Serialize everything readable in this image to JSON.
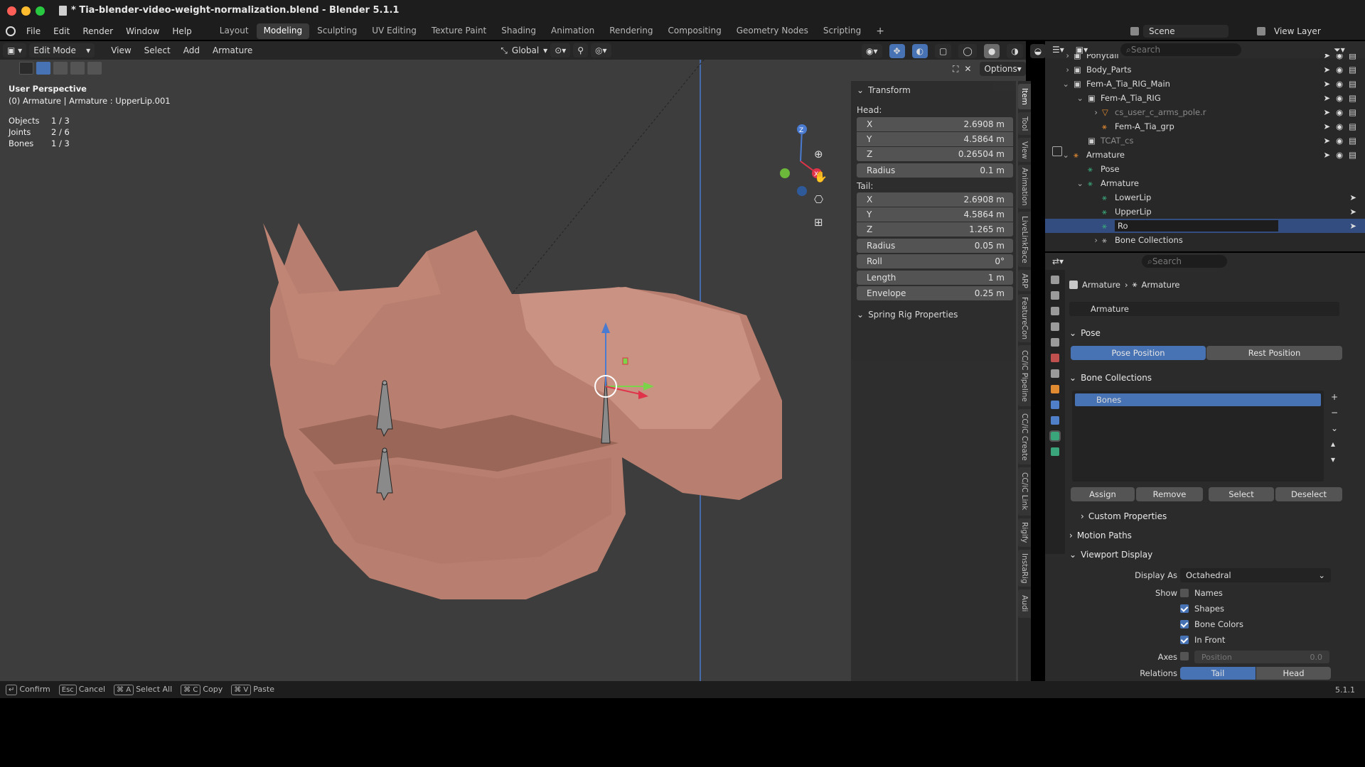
{
  "window": {
    "title": "* Tia-blender-video-weight-normalization.blend - Blender 5.1.1"
  },
  "menu": [
    "File",
    "Edit",
    "Render",
    "Window",
    "Help"
  ],
  "workspaces": [
    "Layout",
    "Modeling",
    "Sculpting",
    "UV Editing",
    "Texture Paint",
    "Shading",
    "Animation",
    "Rendering",
    "Compositing",
    "Geometry Nodes",
    "Scripting"
  ],
  "active_workspace": "Modeling",
  "scene": {
    "label": "Scene",
    "view_layer": "View Layer"
  },
  "viewport_header": {
    "mode": "Edit Mode",
    "menus": [
      "View",
      "Select",
      "Add",
      "Armature"
    ],
    "orientation": "Global",
    "options": "Options"
  },
  "overlay": {
    "perspective": "User Perspective",
    "context": "(0) Armature | Armature : UpperLip.001",
    "stats": [
      {
        "label": "Objects",
        "value": "1 / 3"
      },
      {
        "label": "Joints",
        "value": "2 / 6"
      },
      {
        "label": "Bones",
        "value": "1 / 3"
      }
    ]
  },
  "gizmo": {
    "x": "X",
    "y": "Y",
    "z": "Z"
  },
  "npanel": {
    "transform_title": "Transform",
    "head_label": "Head:",
    "head": [
      {
        "k": "X",
        "v": "2.6908 m"
      },
      {
        "k": "Y",
        "v": "4.5864 m"
      },
      {
        "k": "Z",
        "v": "0.26504 m"
      },
      {
        "k": "Radius",
        "v": "0.1 m"
      }
    ],
    "tail_label": "Tail:",
    "tail": [
      {
        "k": "X",
        "v": "2.6908 m"
      },
      {
        "k": "Y",
        "v": "4.5864 m"
      },
      {
        "k": "Z",
        "v": "1.265 m"
      },
      {
        "k": "Radius",
        "v": "0.05 m"
      },
      {
        "k": "Roll",
        "v": "0°"
      },
      {
        "k": "Length",
        "v": "1 m"
      },
      {
        "k": "Envelope",
        "v": "0.25 m"
      }
    ],
    "spring_title": "Spring Rig Properties"
  },
  "side_tabs": [
    "Item",
    "Tool",
    "View",
    "Animation",
    "LiveLinkFace",
    "ARP",
    "FeatureCon",
    "CC/iC Pipeline",
    "CC/iC Create",
    "CC/iC Link",
    "Rigify",
    "InstaRig",
    "Audi"
  ],
  "outliner": {
    "search_placeholder": "Search",
    "rows": [
      {
        "name": "Ponytail",
        "indent": 0
      },
      {
        "name": "Body_Parts",
        "indent": 0
      },
      {
        "name": "Fem-A_Tia_RIG_Main",
        "indent": 0
      },
      {
        "name": "Fem-A_Tia_RIG",
        "indent": 1
      },
      {
        "name": "cs_user_c_arms_pole.r",
        "indent": 2
      },
      {
        "name": "Fem-A_Tia_grp",
        "indent": 2
      },
      {
        "name": "TCAT_cs",
        "indent": 1
      },
      {
        "name": "Armature",
        "indent": 0
      },
      {
        "name": "Pose",
        "indent": 1
      },
      {
        "name": "Armature",
        "indent": 1
      },
      {
        "name": "LowerLip",
        "indent": 2
      },
      {
        "name": "UpperLip",
        "indent": 2
      },
      {
        "name": "Ro",
        "indent": 2
      },
      {
        "name": "Bone Collections",
        "indent": 2
      }
    ]
  },
  "properties": {
    "search_placeholder": "Search",
    "breadcrumb": [
      "Armature",
      "Armature"
    ],
    "datablock": "Armature",
    "pose": {
      "title": "Pose",
      "pose_position": "Pose Position",
      "rest_position": "Rest Position"
    },
    "bone_collections": {
      "title": "Bone Collections",
      "items": [
        "Bones"
      ],
      "buttons": [
        "Assign",
        "Remove",
        "Select",
        "Deselect"
      ]
    },
    "custom_properties": "Custom Properties",
    "motion_paths": "Motion Paths",
    "viewport_display": {
      "title": "Viewport Display",
      "display_as_label": "Display As",
      "display_as": "Octahedral",
      "show_label": "Show",
      "show": [
        {
          "label": "Names",
          "checked": false
        },
        {
          "label": "Shapes",
          "checked": true
        },
        {
          "label": "Bone Colors",
          "checked": true
        },
        {
          "label": "In Front",
          "checked": true
        }
      ],
      "axes_label": "Axes",
      "axes_position_label": "Position",
      "axes_position_value": "0.0",
      "relations_label": "Relations",
      "relations": [
        "Tail",
        "Head"
      ]
    }
  },
  "statusbar": {
    "hints": [
      {
        "key": "↵",
        "label": "Confirm"
      },
      {
        "key": "Esc",
        "label": "Cancel"
      },
      {
        "key": "⌘ A",
        "label": "Select All"
      },
      {
        "key": "⌘ C",
        "label": "Copy"
      },
      {
        "key": "⌘ V",
        "label": "Paste"
      }
    ],
    "version": "5.1.1"
  },
  "colors": {
    "accent": "#4772b3",
    "skin": "#b87f70",
    "background": "#3d3d3d"
  }
}
